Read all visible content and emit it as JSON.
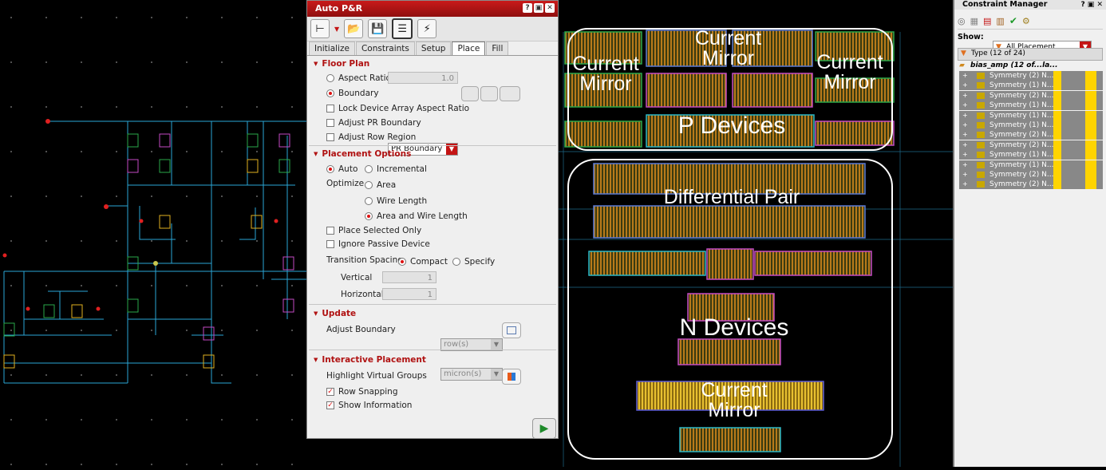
{
  "schematic": {
    "name": "schematic-canvas"
  },
  "auto_pr": {
    "title": "Auto P&R",
    "window_buttons": [
      "?",
      "▣",
      "✕"
    ],
    "tabs": [
      "Initialize",
      "Constraints",
      "Setup",
      "Place",
      "Fill"
    ],
    "active_tab": "Place",
    "floor_plan": {
      "heading": "Floor Plan",
      "aspect_ratio_label": "Aspect Ratio",
      "aspect_ratio_value": "1.0",
      "boundary_label": "Boundary",
      "boundary_value": "PR Boundary",
      "lock_label": "Lock Device Array Aspect Ratio",
      "adjust_pr_label": "Adjust PR Boundary",
      "adjust_row_label": "Adjust Row Region"
    },
    "placement_options": {
      "heading": "Placement Options",
      "auto_label": "Auto",
      "incremental_label": "Incremental",
      "optimize_label": "Optimize",
      "area_label": "Area",
      "wire_length_label": "Wire Length",
      "area_wire_label": "Area and Wire Length",
      "place_selected_label": "Place Selected Only",
      "ignore_passive_label": "Ignore Passive Device",
      "transition_label": "Transition Spacing",
      "compact_label": "Compact",
      "specify_label": "Specify",
      "vertical_label": "Vertical",
      "vertical_value": "1",
      "vertical_unit": "row(s)",
      "horizontal_label": "Horizontal",
      "horizontal_value": "1",
      "horizontal_unit": "micron(s)"
    },
    "update": {
      "heading": "Update",
      "adjust_boundary_label": "Adjust Boundary"
    },
    "interactive": {
      "heading": "Interactive Placement",
      "highlight_label": "Highlight Virtual Groups",
      "row_snapping_label": "Row Snapping",
      "show_info_label": "Show Information"
    }
  },
  "layout": {
    "labels": {
      "cm_left": "Current\nMirror",
      "cm_top": "Current\nMirror",
      "cm_right": "Current\nMirror",
      "p_devices": "P Devices",
      "diff_pair": "Differential Pair",
      "n_devices": "N Devices",
      "cm_bottom": "Current\nMirror"
    }
  },
  "constraint_manager": {
    "title": "Constraint Manager",
    "show_label": "Show:",
    "show_value": "All Placement",
    "type_header": "Type (12 of 24)",
    "root_item": "bias_amp (12 of...la...",
    "items": [
      "Symmetry (2) N...",
      "Symmetry (1) N...",
      "Symmetry (2) N...",
      "Symmetry (1) N...",
      "Symmetry (1) N...",
      "Symmetry (1) N...",
      "Symmetry (2) N...",
      "Symmetry (2) N...",
      "Symmetry (1) N...",
      "Symmetry (1) N...",
      "Symmetry (2) N...",
      "Symmetry (2) N..."
    ]
  },
  "colors": {
    "title_bar": "#b01212",
    "section_heading": "#b01212",
    "wire": "#2aa6d6",
    "layout_outline": "#ffffff",
    "cm_highlight": "#ffd400"
  }
}
